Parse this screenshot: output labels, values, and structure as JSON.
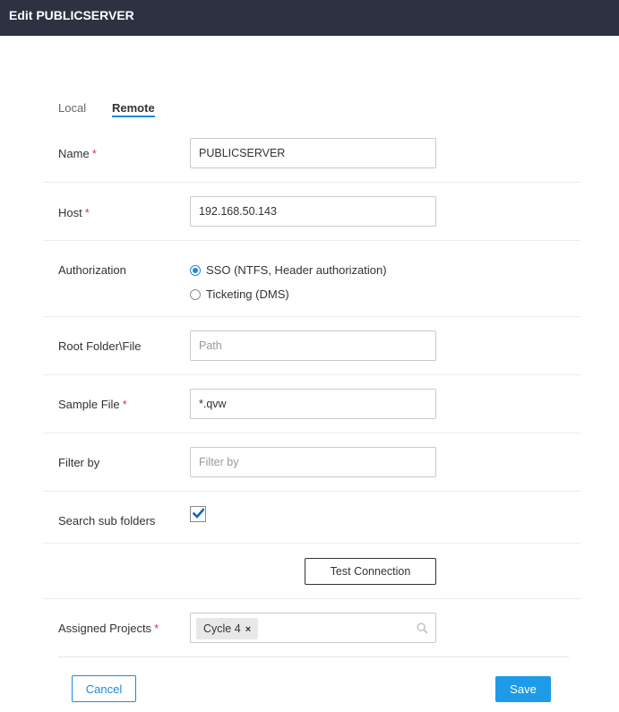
{
  "window": {
    "title": "Edit PUBLICSERVER"
  },
  "tabs": [
    {
      "label": "Local",
      "active": false
    },
    {
      "label": "Remote",
      "active": true
    }
  ],
  "form": {
    "name": {
      "label": "Name",
      "required": "*",
      "value": "PUBLICSERVER"
    },
    "host": {
      "label": "Host",
      "required": "*",
      "value": "192.168.50.143"
    },
    "authorization": {
      "label": "Authorization",
      "options": [
        {
          "label": "SSO (NTFS, Header authorization)",
          "checked": true
        },
        {
          "label": "Ticketing (DMS)",
          "checked": false
        }
      ]
    },
    "root_folder": {
      "label": "Root Folder\\File",
      "value": "",
      "placeholder": "Path"
    },
    "sample_file": {
      "label": "Sample File",
      "required": "*",
      "value": "*.qvw"
    },
    "filter_by": {
      "label": "Filter by",
      "value": "",
      "placeholder": "Filter by"
    },
    "search_sub_folders": {
      "label": "Search sub folders",
      "checked": true
    },
    "test_connection": {
      "label": "Test Connection"
    },
    "assigned_projects": {
      "label": "Assigned Projects",
      "required": "*",
      "tags": [
        {
          "label": "Cycle 4",
          "remove": "×"
        }
      ],
      "icon": "search-icon"
    }
  },
  "footer": {
    "cancel_label": "Cancel",
    "save_label": "Save"
  },
  "colors": {
    "accent": "#1e88e5",
    "titlebar": "#2d3142",
    "required": "#d9363e"
  }
}
